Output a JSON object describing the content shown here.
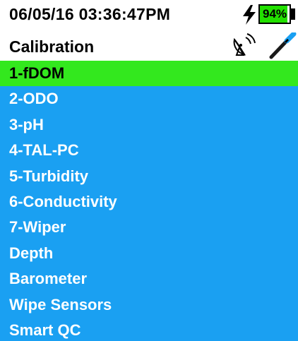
{
  "status": {
    "datetime": "06/05/16 03:36:47PM",
    "charging_icon": "lightning-bolt-icon",
    "battery_percent": "94%",
    "battery_level": 0.94,
    "battery_color": "#22e000"
  },
  "header": {
    "title": "Calibration",
    "icons": [
      "satellite-dish-icon",
      "probe-icon"
    ]
  },
  "menu": {
    "background_color": "#1aa0f2",
    "selected_color": "#33e81e",
    "selected_index": 0,
    "items": [
      {
        "label": "1-fDOM"
      },
      {
        "label": "2-ODO"
      },
      {
        "label": "3-pH"
      },
      {
        "label": "4-TAL-PC"
      },
      {
        "label": "5-Turbidity"
      },
      {
        "label": "6-Conductivity"
      },
      {
        "label": "7-Wiper"
      },
      {
        "label": "Depth"
      },
      {
        "label": "Barometer"
      },
      {
        "label": "Wipe Sensors"
      },
      {
        "label": "Smart QC"
      }
    ]
  }
}
